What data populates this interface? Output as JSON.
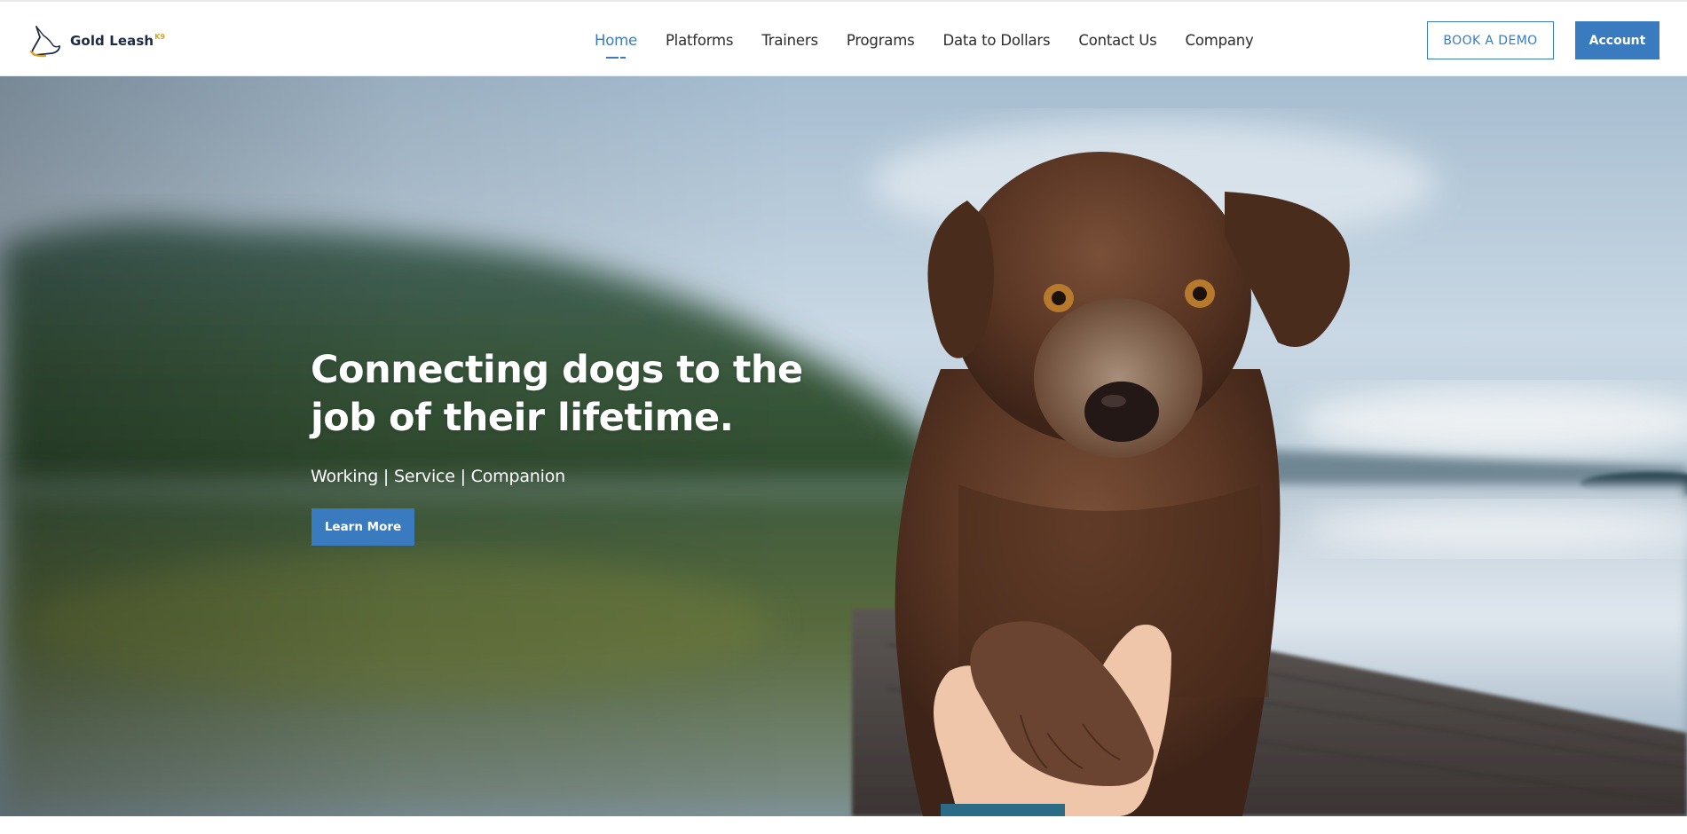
{
  "brand": {
    "name": "Gold Leash",
    "superscript": "K9",
    "logo_icon": "dog-head-logo-icon"
  },
  "nav": {
    "items": [
      {
        "label": "Home",
        "active": true
      },
      {
        "label": "Platforms"
      },
      {
        "label": "Trainers"
      },
      {
        "label": "Programs"
      },
      {
        "label": "Data to Dollars"
      },
      {
        "label": "Contact Us"
      },
      {
        "label": "Company"
      }
    ]
  },
  "header_actions": {
    "demo_label": "BOOK A DEMO",
    "account_label": "Account"
  },
  "hero": {
    "title_line1": "Connecting dogs to the",
    "title_line2": "job of their lifetime.",
    "subtitle": "Working | Service | Companion",
    "cta_label": "Learn More",
    "image": "dog-giving-paw-on-lakeside-dock-photo"
  },
  "colors": {
    "accent": "#3a7bbf",
    "brand_gold": "#d9a31e",
    "brand_navy": "#1d2a44"
  }
}
